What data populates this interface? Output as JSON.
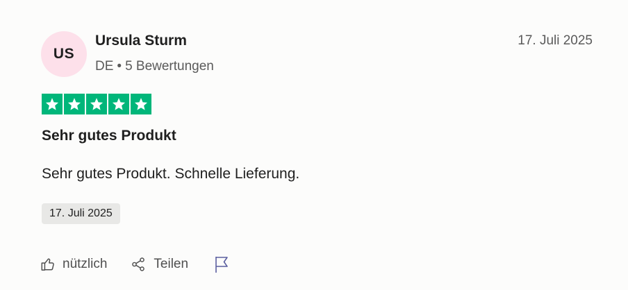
{
  "review": {
    "author": {
      "initials": "US",
      "name": "Ursula Sturm",
      "country": "DE",
      "separator": "•",
      "reviews_count": "5 Bewertungen"
    },
    "posted_date": "17. Juli 2025",
    "rating": 5,
    "rating_max": 5,
    "title": "Sehr gutes Produkt",
    "text": "Sehr gutes Produkt. Schnelle Lieferung.",
    "experience_date": "17. Juli 2025"
  },
  "actions": {
    "useful_label": "nützlich",
    "share_label": "Teilen"
  },
  "colors": {
    "star_green": "#00b67a",
    "avatar_bg": "#fde0ea",
    "badge_bg": "#e8e8e6",
    "flag_icon": "#5b5fa0"
  },
  "icons": {
    "useful": "thumbs-up-icon",
    "share": "share-icon",
    "report": "flag-icon",
    "star": "star-icon"
  }
}
